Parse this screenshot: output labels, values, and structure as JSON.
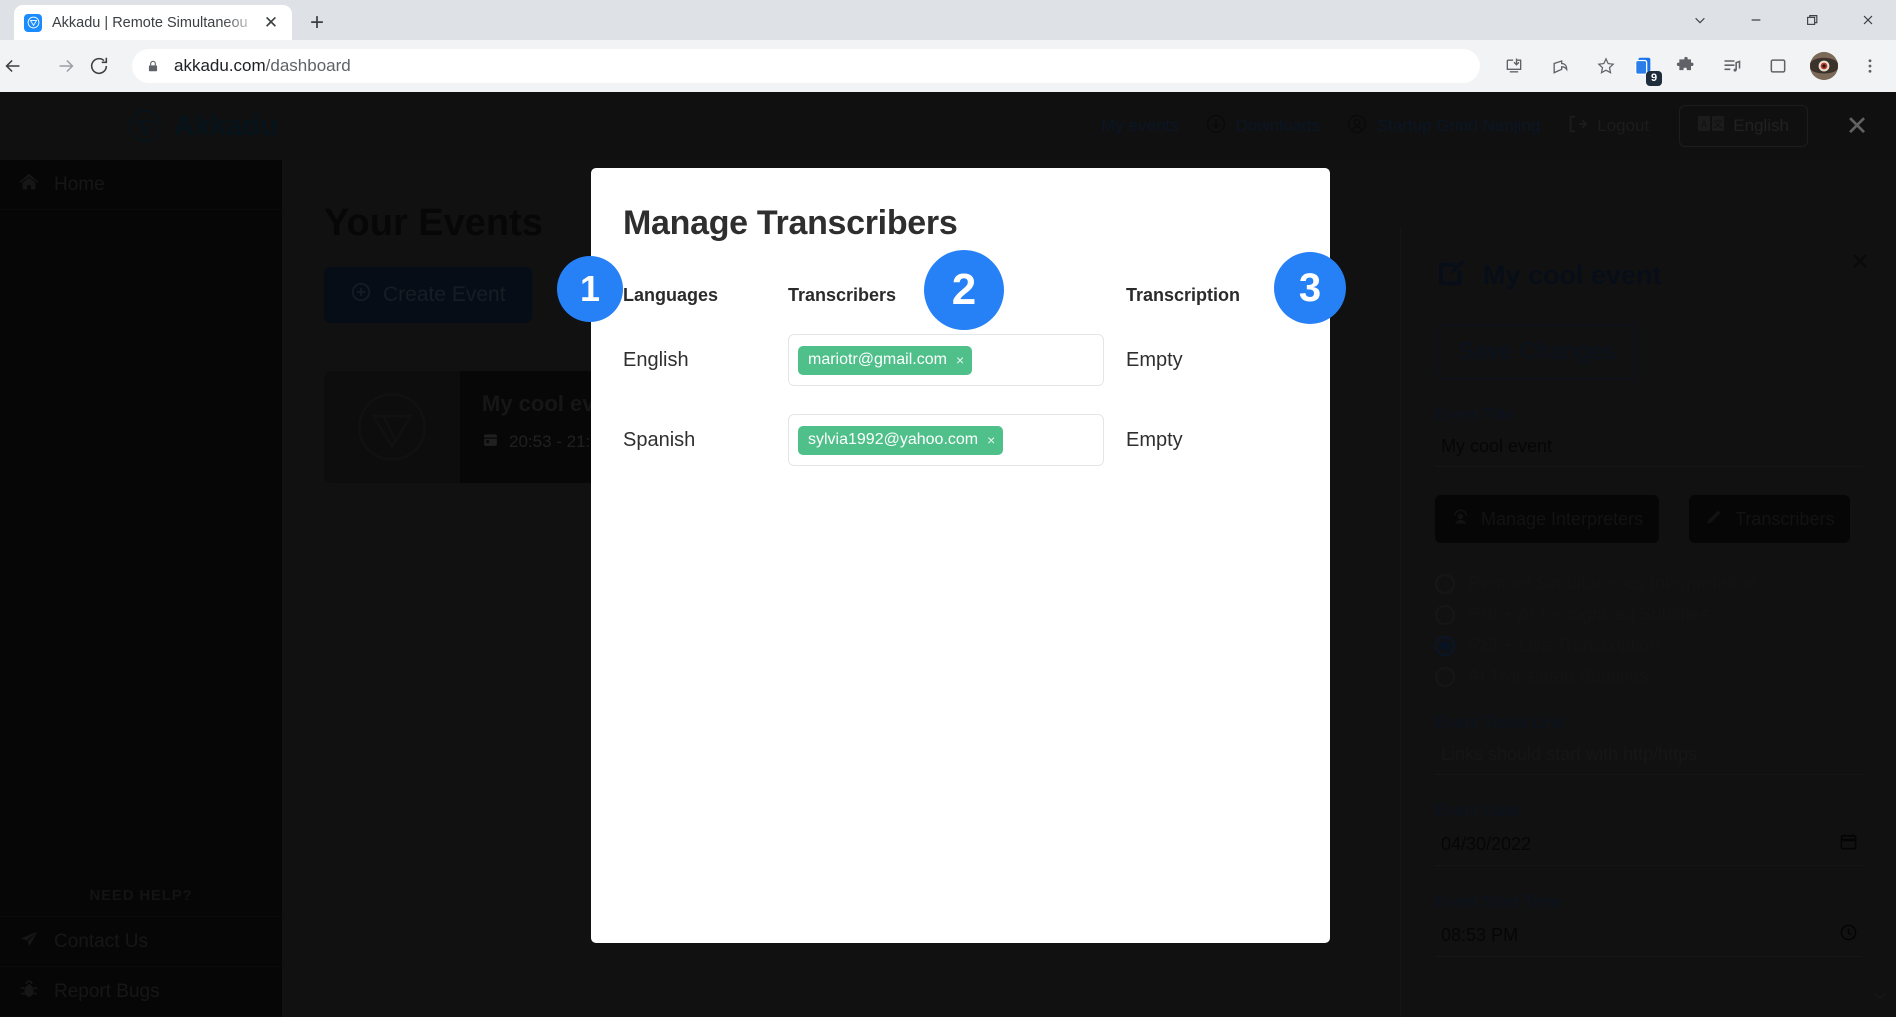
{
  "browser": {
    "tab": {
      "title": "Akkadu | Remote Simultaneou",
      "close_label": "✕"
    },
    "new_tab_label": "+",
    "url_host": "akkadu.com",
    "url_path": "/dashboard",
    "extension_badge_count": "9",
    "window_controls": {
      "chevron": "chevron-down",
      "minimize": "minimize",
      "restore": "restore",
      "close": "close"
    }
  },
  "app_header": {
    "brand": "Akkadu",
    "nav": [
      {
        "label": "My events",
        "icon": "calendar-icon"
      },
      {
        "label": "Downloads",
        "icon": "download-circle-icon"
      },
      {
        "label": "Startup Grind Nanjing",
        "icon": "user-circle-icon"
      },
      {
        "label": "Logout",
        "icon": "logout-icon"
      }
    ],
    "language_button": "English",
    "close_label": "✕"
  },
  "sidebar": {
    "items": [
      {
        "label": "Home",
        "icon": "home-icon"
      }
    ],
    "help_header": "NEED HELP?",
    "help_items": [
      {
        "label": "Contact Us",
        "icon": "paper-plane-icon"
      },
      {
        "label": "Report Bugs",
        "icon": "bug-icon"
      }
    ]
  },
  "main": {
    "title": "Your Events",
    "create_button": "Create Event",
    "event_card": {
      "title": "My cool ev",
      "time": "20:53 - 21:"
    }
  },
  "detail": {
    "title": "My cool event",
    "close_label": "✕",
    "save_button": "Save Changes",
    "event_title_label": "Event Title",
    "event_title_value": "My cool event",
    "manage_interpreters_button": "Manage Interpreters",
    "transcribers_button": "Transcribers",
    "modes": [
      {
        "label": "Remote Simultaneous Interpretation",
        "selected": false
      },
      {
        "label": "RSI + AI Recognized Subtitles",
        "selected": false
      },
      {
        "label": "RSI + Live Transcription",
        "selected": true
      },
      {
        "label": "AI Translated Subtitles",
        "selected": false
      }
    ],
    "ticket_link_label": "Event Ticket Link",
    "ticket_link_placeholder": "Links should start with http/https",
    "event_date_label": "Event Date",
    "event_date_value": "04/30/2022",
    "event_start_label": "Event Start Time",
    "event_start_value": "08:53 PM"
  },
  "modal": {
    "title": "Manage Transcribers",
    "columns": {
      "languages": "Languages",
      "transcribers": "Transcribers",
      "transcription": "Transcription"
    },
    "rows": [
      {
        "language": "English",
        "tag": "mariotr@gmail.com",
        "tag_remove": "×",
        "transcription": "Empty"
      },
      {
        "language": "Spanish",
        "tag": "sylvia1992@yahoo.com",
        "tag_remove": "×",
        "transcription": "Empty"
      }
    ]
  },
  "annotations": [
    {
      "number": "1"
    },
    {
      "number": "2"
    },
    {
      "number": "3"
    }
  ],
  "colors": {
    "accent_blue": "#2680f6",
    "tag_green": "#4fc08a",
    "brand_navy": "#123347"
  }
}
